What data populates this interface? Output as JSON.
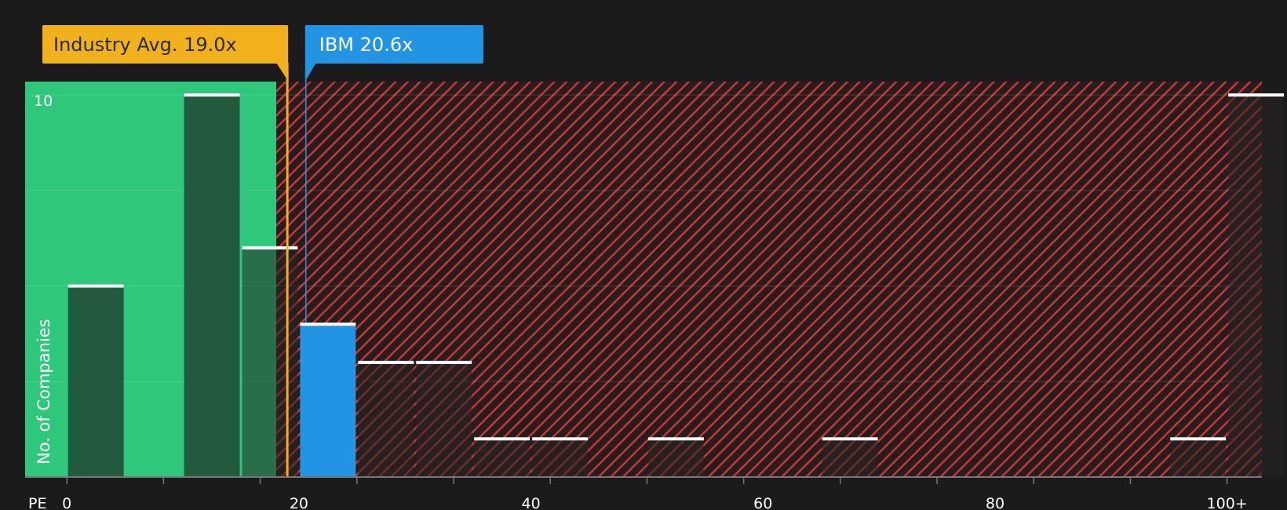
{
  "chart_data": {
    "type": "bar",
    "xlabel": "PE",
    "ylabel": "No. of Companies",
    "x_ticks": [
      "0",
      "20",
      "40",
      "60",
      "80",
      "100+"
    ],
    "y_ticks": [
      "10"
    ],
    "bins": [
      {
        "x0": 0,
        "x1": 5,
        "count": 5
      },
      {
        "x0": 10,
        "x1": 15,
        "count": 10
      },
      {
        "x0": 15,
        "x1": 20,
        "count": 6
      },
      {
        "x0": 20,
        "x1": 25,
        "count": 4,
        "highlight": true
      },
      {
        "x0": 25,
        "x1": 30,
        "count": 3
      },
      {
        "x0": 30,
        "x1": 35,
        "count": 3
      },
      {
        "x0": 35,
        "x1": 40,
        "count": 1
      },
      {
        "x0": 40,
        "x1": 45,
        "count": 1
      },
      {
        "x0": 50,
        "x1": 55,
        "count": 1
      },
      {
        "x0": 65,
        "x1": 70,
        "count": 1
      },
      {
        "x0": 95,
        "x1": 100,
        "count": 1
      },
      {
        "x0": 100,
        "x1": 105,
        "count": 10
      }
    ],
    "xlim": [
      -3.6,
      103
    ],
    "ylim": [
      0,
      10.35
    ],
    "industry_avg": {
      "label": "Industry Avg. 19.0x",
      "value": 19.0
    },
    "company": {
      "label": "IBM 20.6x",
      "value": 20.6
    },
    "colors": {
      "background": "#1b1b1b",
      "undervalued_zone": "#2ec77c",
      "overvalued_hatch": "#c73a3a",
      "industry_avg": "#f0b11d",
      "company": "#2394e3",
      "bar": "#1f4633",
      "bar_cap": "#ffffff"
    }
  }
}
